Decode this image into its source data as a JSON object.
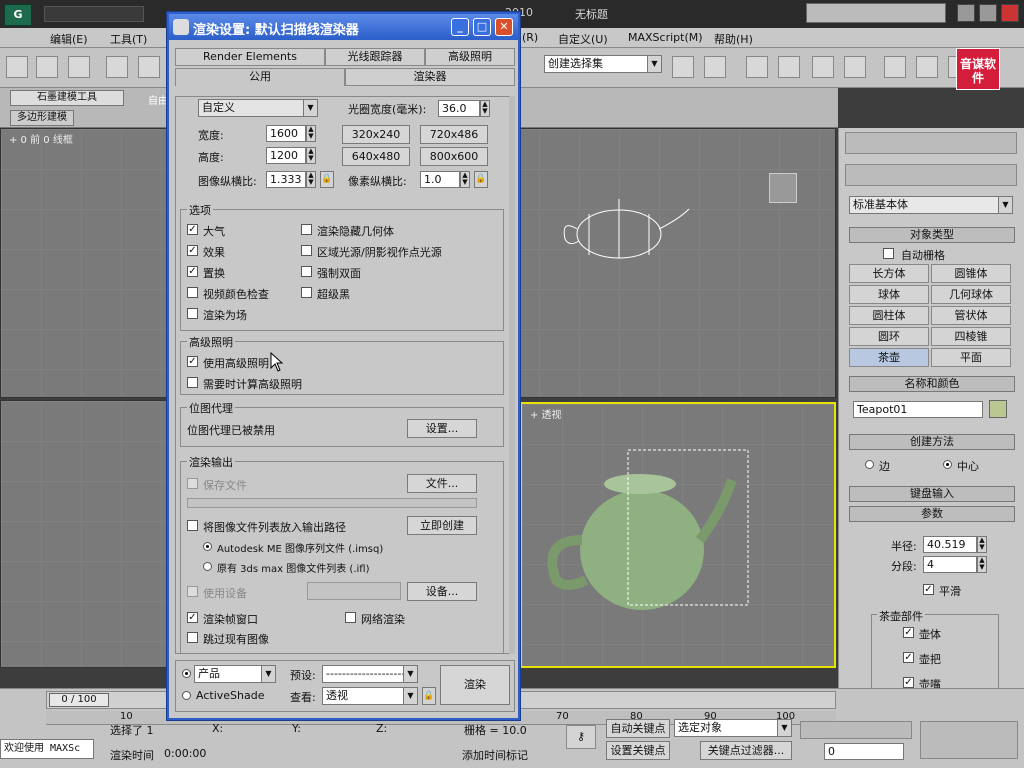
{
  "app": {
    "title_left": "2010",
    "title_right": "无标题",
    "menus": [
      "编辑(E)",
      "工具(T)",
      "(R)",
      "自定义(U)",
      "MAXScript(M)",
      "帮助(H)"
    ],
    "selset": "创建选择集",
    "ribbon_tab": "石墨建模工具",
    "ribbon_tab2": "自由",
    "ribbon_sub": "多边形建模",
    "logo": "音谋软件"
  },
  "viewports": {
    "top_label": "+ 0 前 0 线框",
    "bottom_right_label": "+ 透视"
  },
  "command_panel": {
    "dropdown": "标准基本体",
    "object_type": "对象类型",
    "autogrid": "自动栅格",
    "buttons": [
      "长方体",
      "圆锥体",
      "球体",
      "几何球体",
      "圆柱体",
      "管状体",
      "圆环",
      "四棱锥",
      "茶壶",
      "平面"
    ],
    "name_color": "名称和颜色",
    "name_value": "Teapot01",
    "creation_method": "创建方法",
    "edge": "边",
    "center": "中心",
    "keyboard": "键盘输入",
    "params": "参数",
    "radius_label": "半径:",
    "radius": "40.519",
    "segments_label": "分段:",
    "segments": "4",
    "smooth": "平滑",
    "parts": "茶壶部件",
    "body": "壶体",
    "handle": "壶把",
    "spout": "壶嘴",
    "lid": "壶盖"
  },
  "status": {
    "frame": "0 / 100",
    "ticks": [
      "10",
      "70",
      "80",
      "90",
      "100"
    ],
    "selected": "选择了 1",
    "x_label": "X:",
    "y_label": "Y:",
    "z_label": "Z:",
    "grid": "栅格 = 10.0",
    "welcome": "欢迎使用 MAXSc",
    "render_time_label": "渲染时间",
    "render_time": "0:00:00",
    "add_tag": "添加时间标记",
    "autokey": "自动关键点",
    "setkey": "设置关键点",
    "selected_obj": "选定对象",
    "key_filters": "关键点过滤器...",
    "frame_num": "0"
  },
  "dialog": {
    "title": "渲染设置: 默认扫描线渲染器",
    "tabs_top": [
      "Render Elements",
      "光线跟踪器",
      "高级照明"
    ],
    "tabs_bottom": [
      "公用",
      "渲染器"
    ],
    "size_preset": "自定义",
    "aperture_label": "光圈宽度(毫米):",
    "aperture": "36.0",
    "width_label": "宽度:",
    "width": "1600",
    "height_label": "高度:",
    "height": "1200",
    "presets": [
      "320x240",
      "720x486",
      "640x480",
      "800x600"
    ],
    "aspect_label": "图像纵横比:",
    "aspect": "1.333",
    "pixel_aspect_label": "像素纵横比:",
    "pixel_aspect": "1.0",
    "options_title": "选项",
    "options_left": [
      {
        "label": "大气",
        "checked": true
      },
      {
        "label": "效果",
        "checked": true
      },
      {
        "label": "置换",
        "checked": true
      },
      {
        "label": "视频颜色检查",
        "checked": false
      },
      {
        "label": "渲染为场",
        "checked": false
      }
    ],
    "options_right": [
      {
        "label": "渲染隐藏几何体",
        "checked": false
      },
      {
        "label": "区域光源/阴影视作点光源",
        "checked": false
      },
      {
        "label": "强制双面",
        "checked": false
      },
      {
        "label": "超级黑",
        "checked": false
      }
    ],
    "adv_title": "高级照明",
    "adv_use": "使用高级照明",
    "adv_compute": "需要时计算高级照明",
    "bitmap_title": "位图代理",
    "bitmap_text": "位图代理已被禁用",
    "setup_btn": "设置...",
    "output_title": "渲染输出",
    "save_file": "保存文件",
    "files_btn": "文件...",
    "put_list": "将图像文件列表放入输出路径",
    "create_now": "立即创建",
    "autodesk_list": "Autodesk ME 图像序列文件 (.imsq)",
    "legacy_list": "原有 3ds max 图像文件列表 (.ifl)",
    "use_device": "使用设备",
    "device_btn": "设备...",
    "frame_window": "渲染帧窗口",
    "net_render": "网络渲染",
    "skip_existing": "跳过现有图像",
    "product": "产品",
    "activeshade": "ActiveShade",
    "preset_label": "预设:",
    "preset_value": "--------------------",
    "view_label": "查看:",
    "view_value": "透视",
    "render_btn": "渲染"
  }
}
